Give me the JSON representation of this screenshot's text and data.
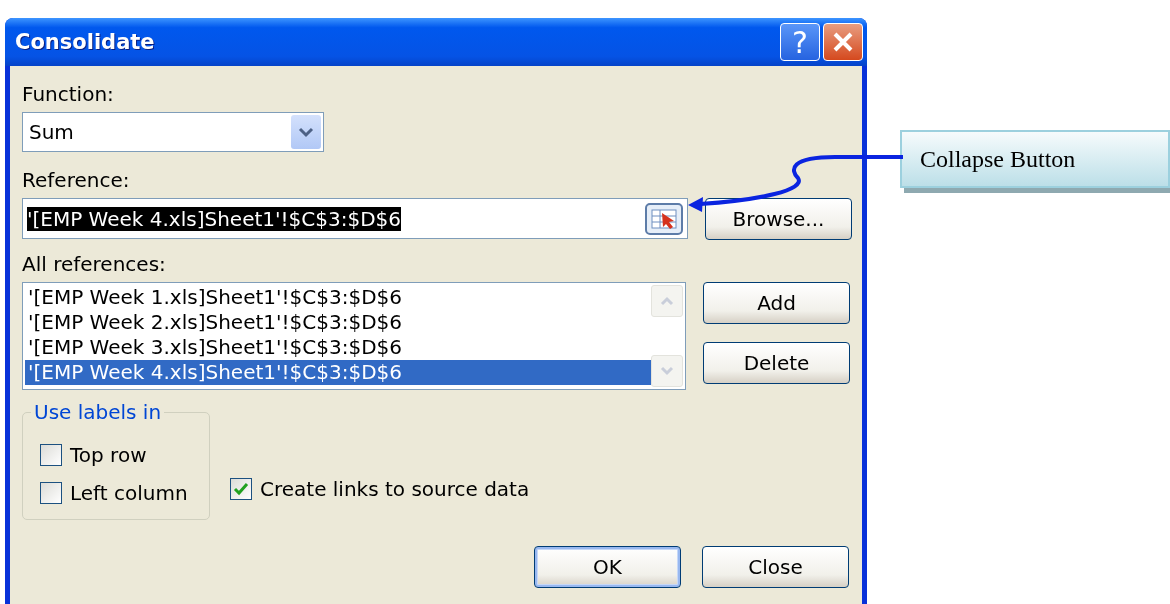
{
  "window": {
    "title": "Consolidate",
    "help": "?"
  },
  "function": {
    "label": "Function:",
    "value": "Sum"
  },
  "reference": {
    "label": "Reference:",
    "value": "'[EMP Week 4.xls]Sheet1'!$C$3:$D$6",
    "highlighted": true
  },
  "all_references": {
    "label": "All references:",
    "items": [
      {
        "text": "'[EMP Week 1.xls]Sheet1'!$C$3:$D$6",
        "selected": false
      },
      {
        "text": "'[EMP Week 2.xls]Sheet1'!$C$3:$D$6",
        "selected": false
      },
      {
        "text": "'[EMP Week 3.xls]Sheet1'!$C$3:$D$6",
        "selected": false
      },
      {
        "text": "'[EMP Week 4.xls]Sheet1'!$C$3:$D$6",
        "selected": true
      }
    ]
  },
  "side_buttons": [
    {
      "label": "Browse...",
      "default": false
    },
    {
      "label": "Add",
      "default": false
    },
    {
      "label": "Delete",
      "default": false
    }
  ],
  "use_labels": {
    "title": "Use labels in",
    "options": [
      {
        "label": "Top row",
        "checked": false
      },
      {
        "label": "Left column",
        "checked": false
      }
    ]
  },
  "create_links": {
    "label": "Create links to source data",
    "checked": true
  },
  "footer_buttons": [
    {
      "label": "OK",
      "default": true
    },
    {
      "label": "Close",
      "default": false
    }
  ],
  "callout": {
    "text": "Collapse Button"
  }
}
